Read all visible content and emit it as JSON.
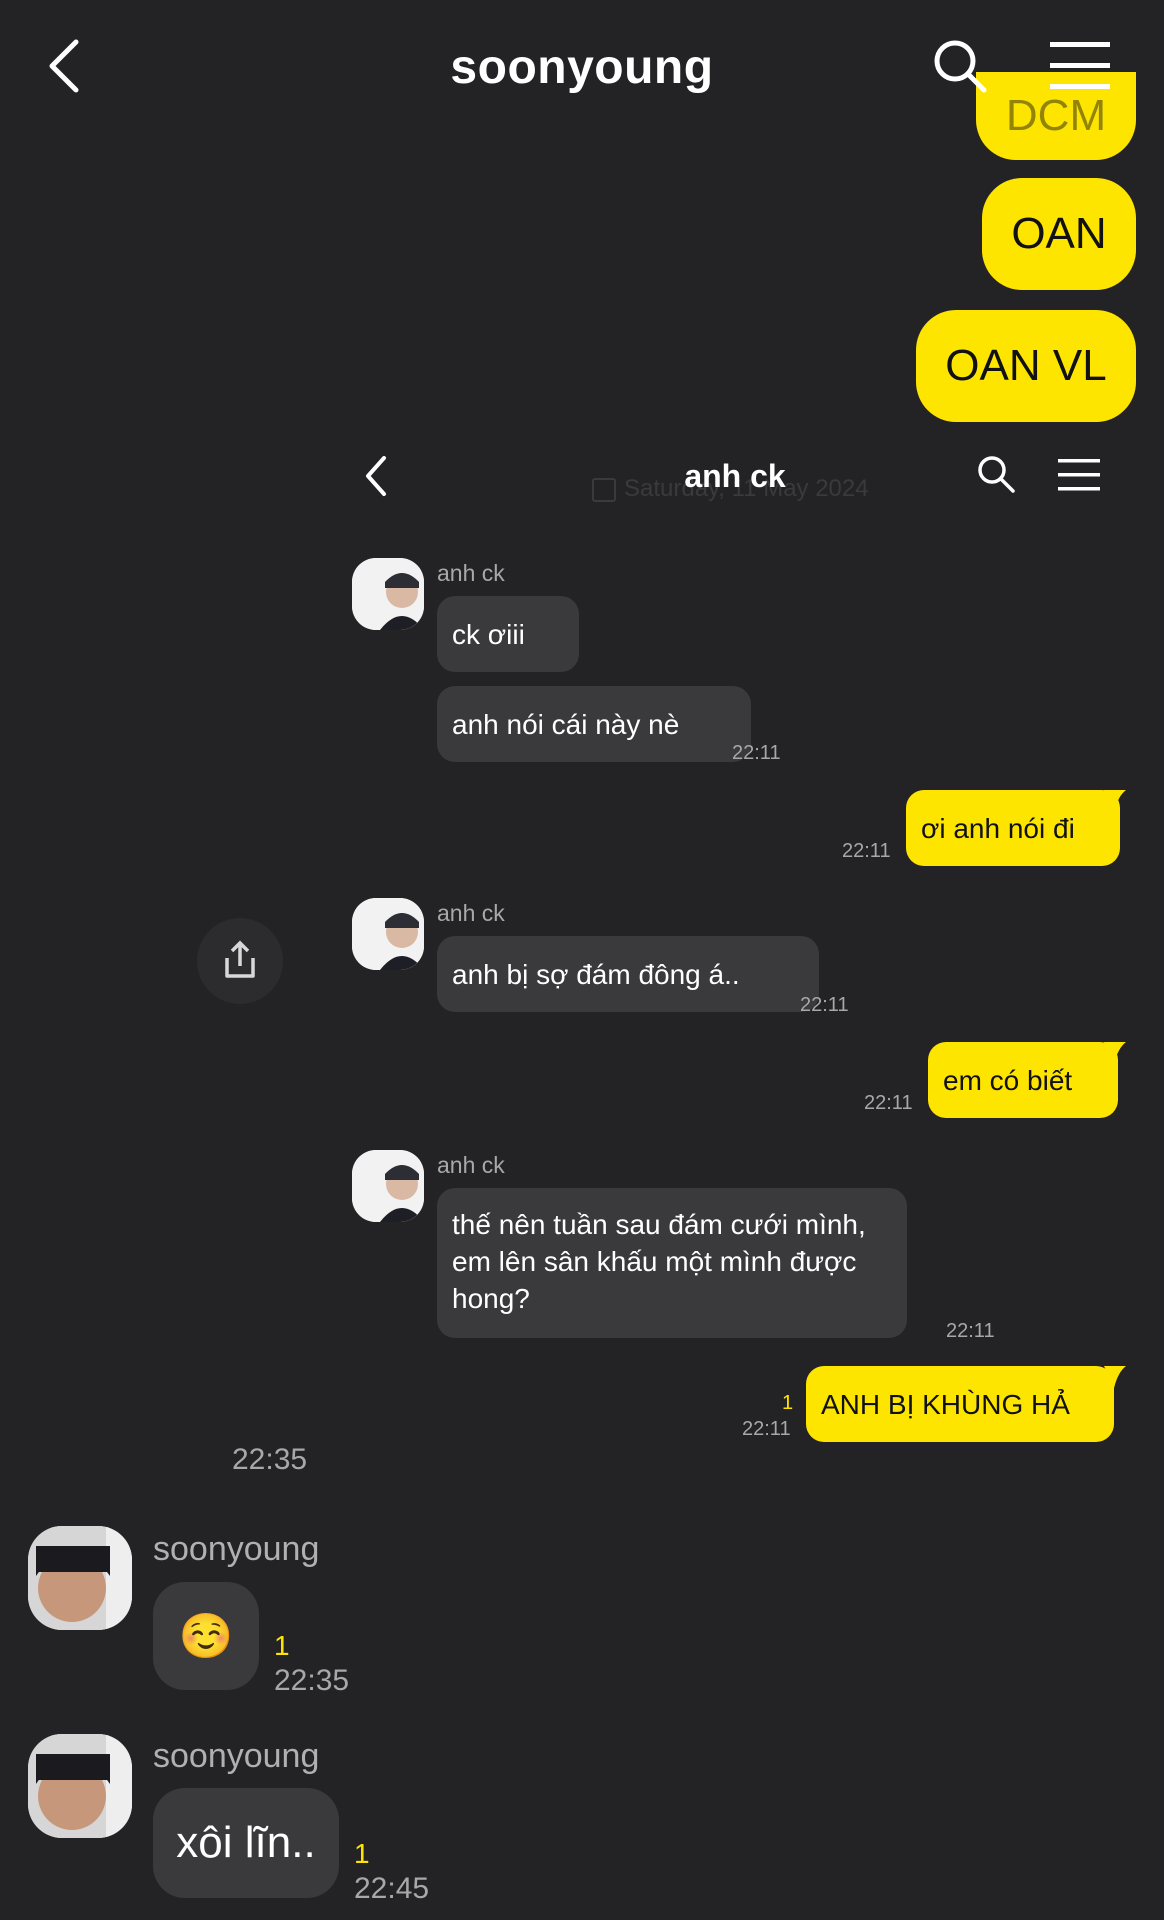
{
  "header": {
    "title": "soonyoung"
  },
  "top_messages": [
    {
      "text": "DCM"
    },
    {
      "text": "OAN"
    },
    {
      "text": "OAN VL"
    }
  ],
  "inner": {
    "title": "anh ck",
    "date_label": "Saturday, 11 May 2024",
    "messages": [
      {
        "sender": "anh ck",
        "texts": [
          "ck ơiii",
          "anh nói cái này nè"
        ],
        "time": "22:11"
      },
      {
        "mine": true,
        "text": "ơi anh nói đi",
        "time": "22:11"
      },
      {
        "sender": "anh ck",
        "texts": [
          "anh bị sợ đám đông á.."
        ],
        "time": "22:11"
      },
      {
        "mine": true,
        "text": "em có biết",
        "time": "22:11"
      },
      {
        "sender": "anh ck",
        "texts": [
          "thế nên tuần sau đám cưới mình, em lên sân khấu một mình được hong?"
        ],
        "time": "22:11"
      },
      {
        "mine": true,
        "text": "ANH BỊ KHÙNG HẢ",
        "time": "22:11",
        "unread": "1"
      }
    ]
  },
  "image_time": "22:35",
  "chat": [
    {
      "sender": "soonyoung",
      "text": "☺️",
      "unread": "1",
      "time": "22:35"
    },
    {
      "sender": "soonyoung",
      "text": "xôi lĩn..",
      "unread": "1",
      "time": "22:45"
    }
  ],
  "colors": {
    "background": "#232325",
    "accent_yellow": "#FEE500",
    "bubble_dark": "#3a3a3d"
  },
  "icons": [
    "back-chevron-icon",
    "search-icon",
    "menu-icon",
    "share-icon"
  ]
}
